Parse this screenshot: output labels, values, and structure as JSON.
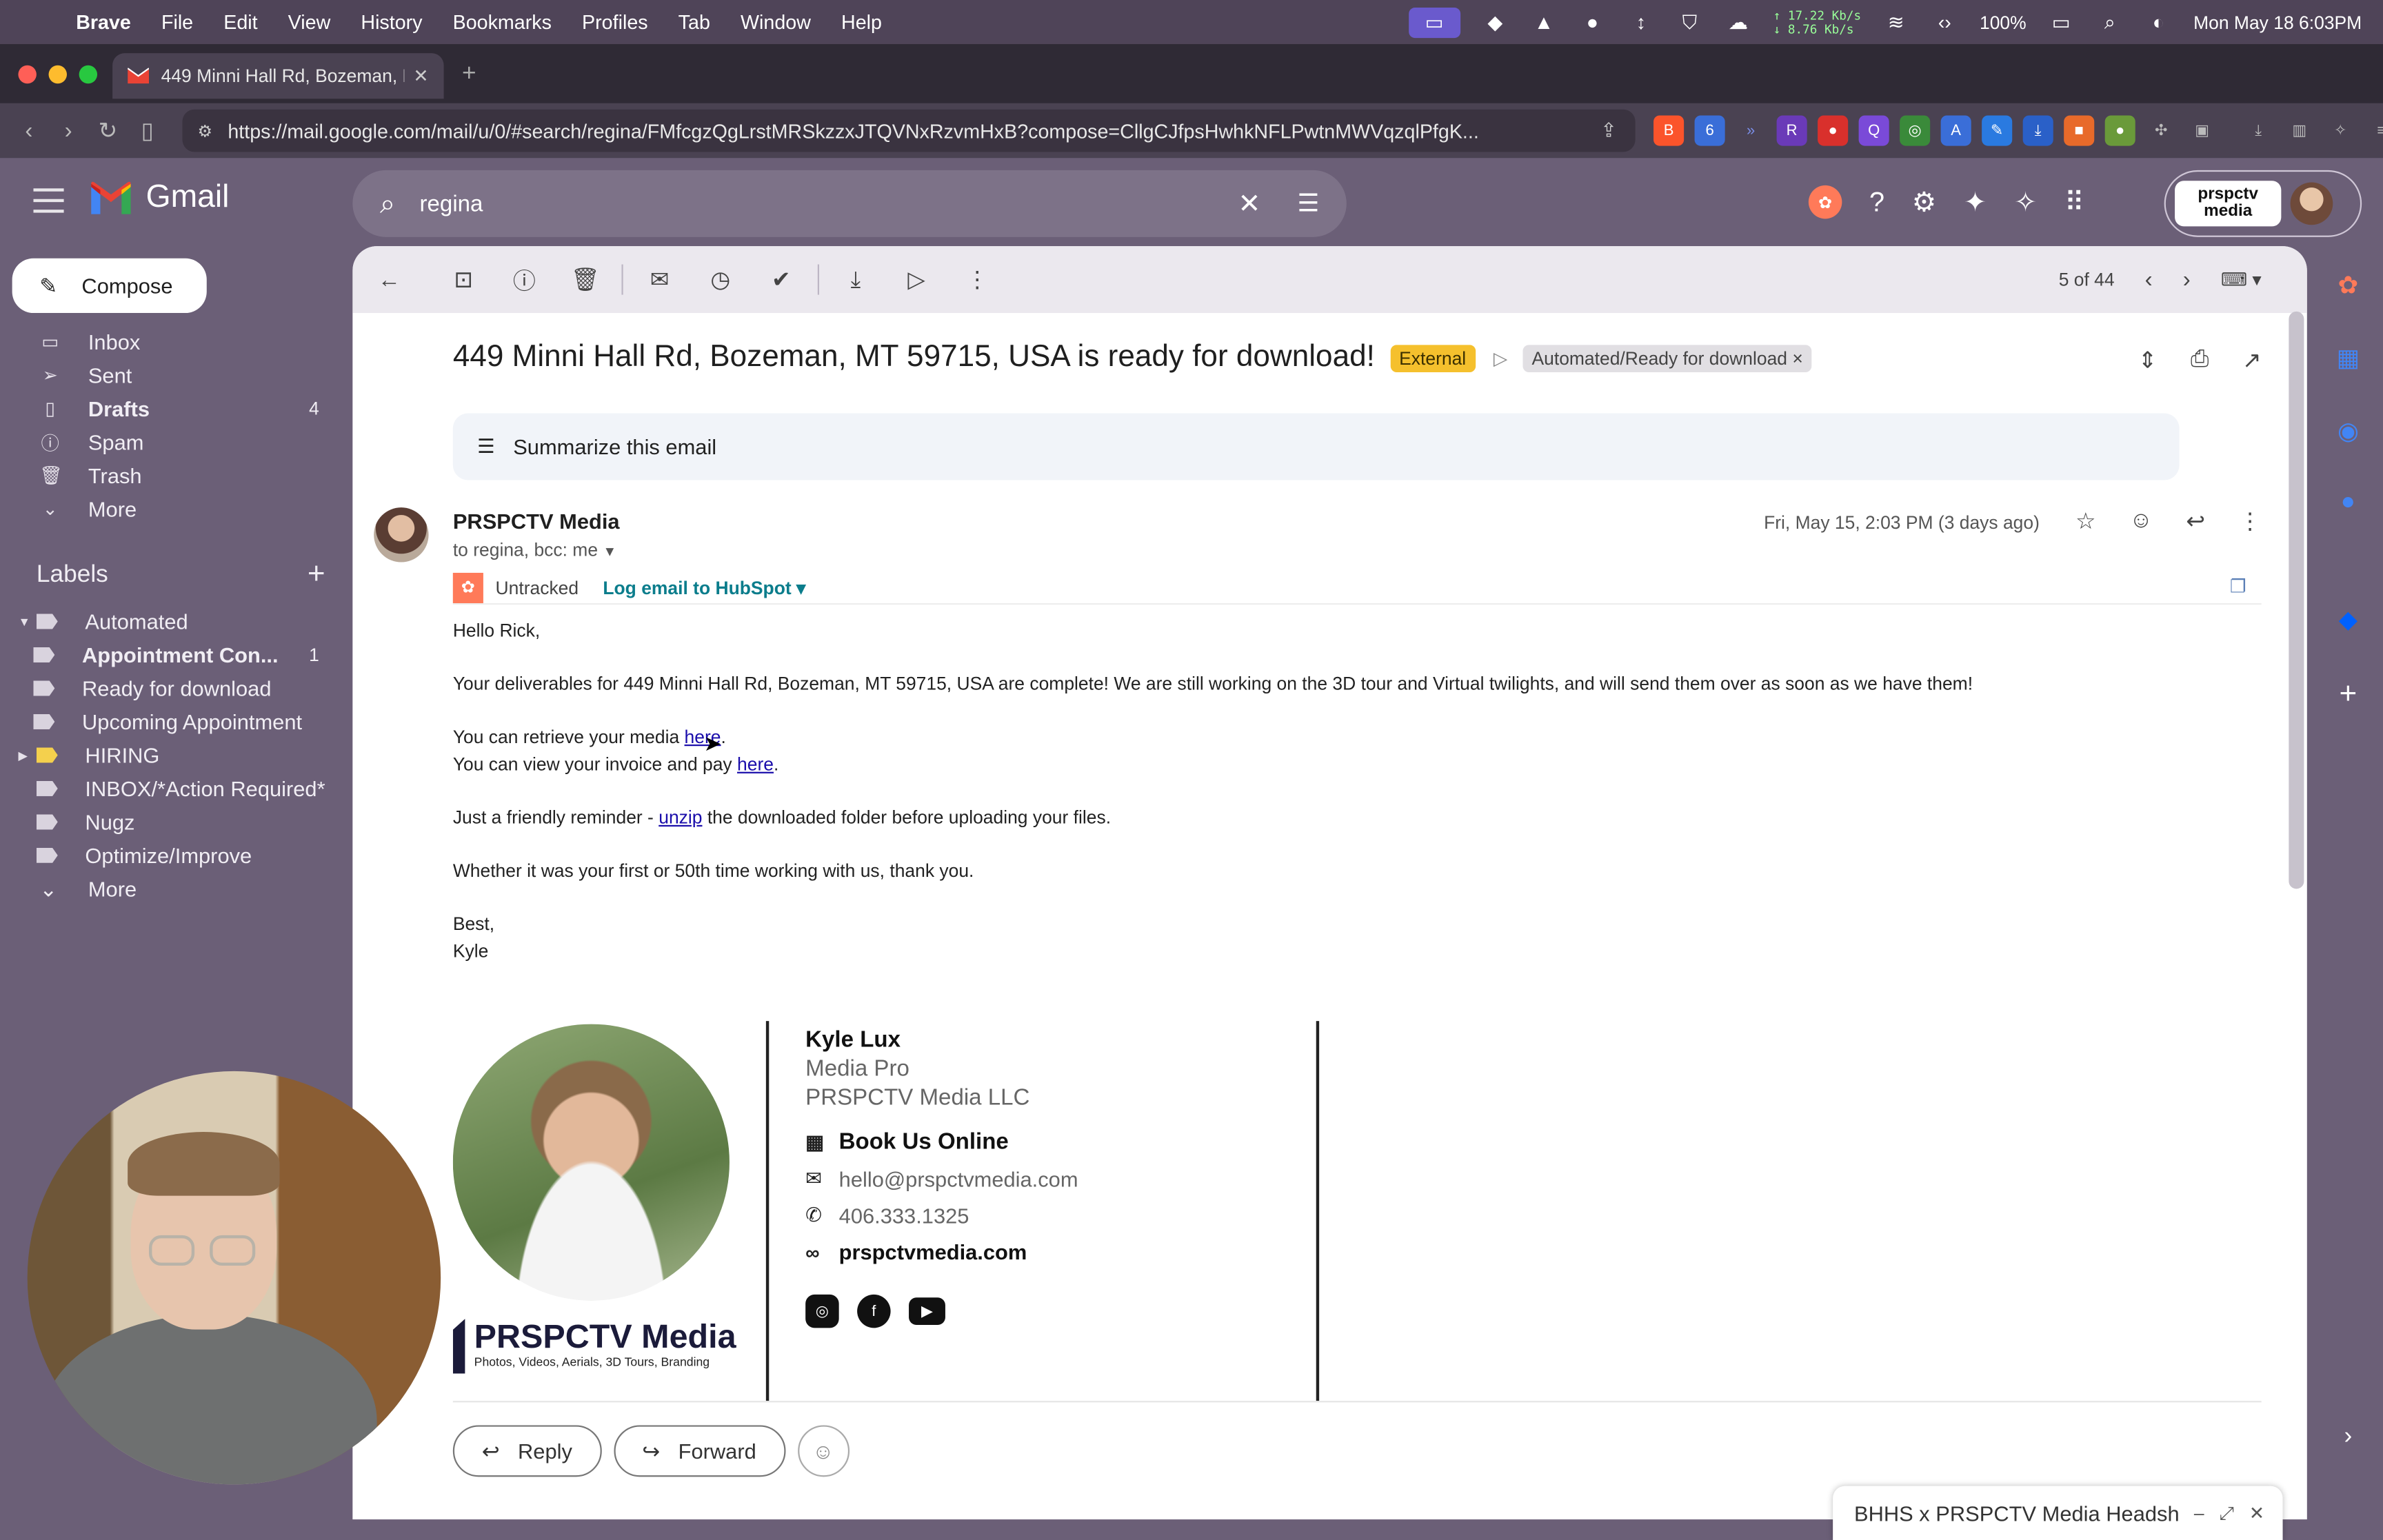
{
  "menubar": {
    "app": "Brave",
    "menus": [
      "File",
      "Edit",
      "View",
      "History",
      "Bookmarks",
      "Profiles",
      "Tab",
      "Window",
      "Help"
    ],
    "net_up": "↑ 17.22 Kb/s",
    "net_down": "↓ 8.76 Kb/s",
    "battery": "100%",
    "clock": "Mon May 18  6:03PM"
  },
  "browser": {
    "tab_title": "449 Minni Hall Rd, Bozeman, M",
    "url": "https://mail.google.com/mail/u/0/#search/regina/FMfcgzQgLrstMRSkzzxJTQVNxRzvmHxB?compose=CllgCJfpsHwhkNFLPwtnMWVqzqlPfgK..."
  },
  "gmail": {
    "logo_text": "Gmail",
    "search_query": "regina",
    "account_logo": "prspctv media"
  },
  "sidebar": {
    "compose": "Compose",
    "items": [
      {
        "label": "Inbox",
        "count": ""
      },
      {
        "label": "Sent",
        "count": ""
      },
      {
        "label": "Drafts",
        "count": "4"
      },
      {
        "label": "Spam",
        "count": ""
      },
      {
        "label": "Trash",
        "count": ""
      },
      {
        "label": "More",
        "count": ""
      }
    ],
    "labels_title": "Labels",
    "labels": [
      {
        "label": "Automated",
        "count": ""
      },
      {
        "label": "Appointment Con...",
        "count": "1"
      },
      {
        "label": "Ready for download",
        "count": ""
      },
      {
        "label": "Upcoming Appointment",
        "count": ""
      },
      {
        "label": "HIRING",
        "count": ""
      },
      {
        "label": "INBOX/*Action Required*",
        "count": ""
      },
      {
        "label": "Nugz",
        "count": ""
      },
      {
        "label": "Optimize/Improve",
        "count": ""
      },
      {
        "label": "More",
        "count": ""
      }
    ]
  },
  "toolbar": {
    "pager": "5 of 44"
  },
  "email": {
    "subject": "449 Minni Hall Rd, Bozeman, MT 59715, USA is ready for download!",
    "badge": "External",
    "label_chip": "Automated/Ready for download",
    "chip_close": "×",
    "summarize": "Summarize this email",
    "sender": "PRSPCTV Media",
    "to": "to regina, bcc: me",
    "date": "Fri, May 15, 2:03 PM (3 days ago)",
    "hubspot_status": "Untracked",
    "hubspot_log": "Log email to HubSpot ▾",
    "greeting": "Hello Rick,",
    "para1": "Your deliverables for 449 Minni Hall Rd, Bozeman, MT 59715, USA are complete! We are still working on the 3D tour and Virtual twilights, and will send them over as soon as we have them!",
    "media_line_pre": "You can retrieve your media ",
    "media_link": "here",
    "invoice_line_pre": "You can view your invoice and pay ",
    "invoice_link": "here",
    "reminder_pre": "Just a friendly reminder - ",
    "reminder_link": "unzip",
    "reminder_post": " the downloaded folder before uploading your files.",
    "thanks": "Whether it was your first or 50th time working with us, thank you.",
    "signoff": "Best,",
    "signoff_name": "Kyle"
  },
  "signature": {
    "name": "Kyle Lux",
    "role": "Media Pro",
    "company": "PRSPCTV Media LLC",
    "book": "Book Us Online",
    "email": "hello@prspctvmedia.com",
    "phone": "406.333.1325",
    "website": "prspctvmedia.com",
    "brand": "PRSPCTV Media",
    "tagline": "Photos, Videos, Aerials, 3D Tours, Branding"
  },
  "actions": {
    "reply": "Reply",
    "forward": "Forward"
  },
  "draft": {
    "title": "BHHS x PRSPCTV Media Headsho..."
  }
}
